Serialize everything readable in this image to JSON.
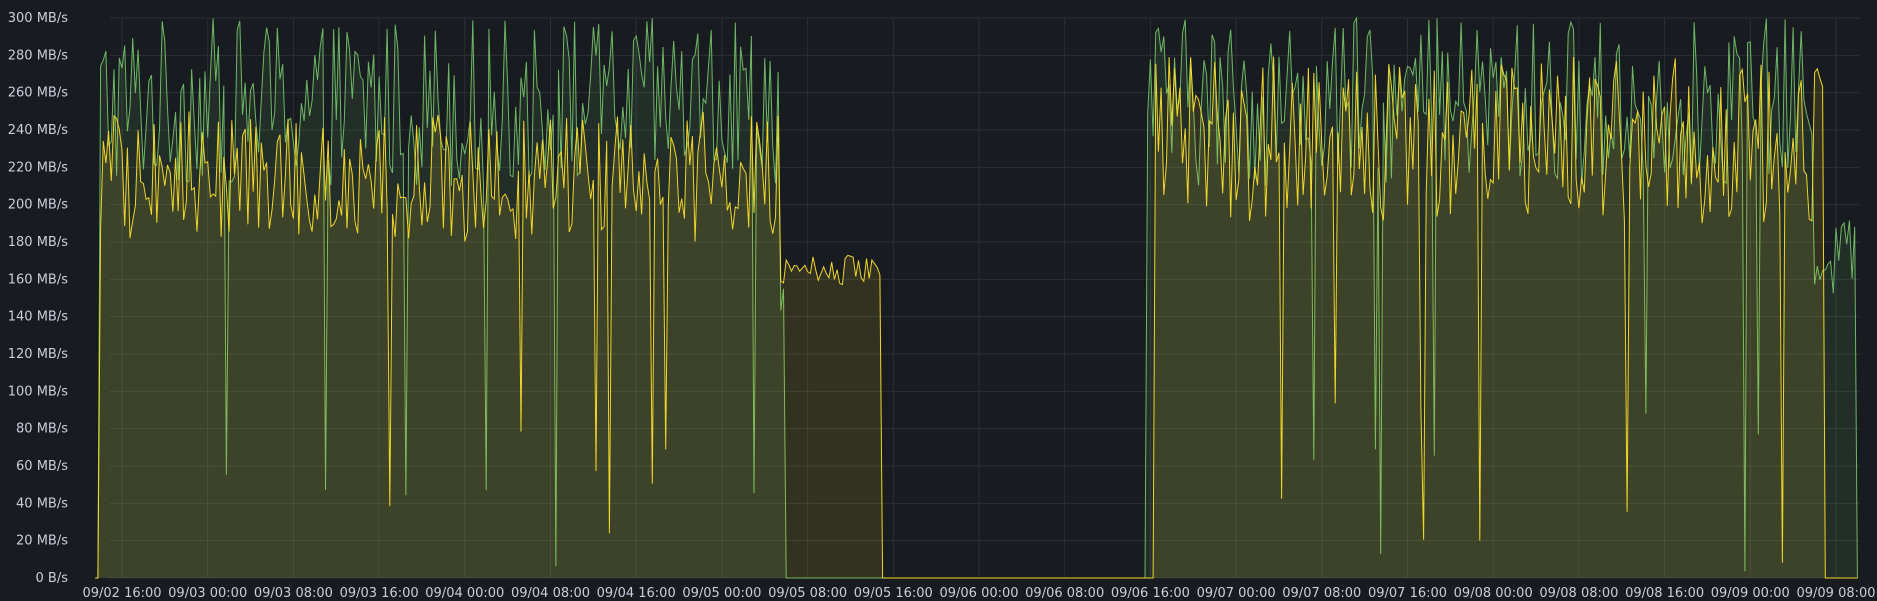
{
  "chart_data": {
    "type": "line",
    "title": "",
    "xlabel": "",
    "ylabel": "",
    "y_unit": "MB/s",
    "ylim": [
      0,
      300
    ],
    "grid": true,
    "legend": "none",
    "y_ticks": [
      "0 B/s",
      "20 MB/s",
      "40 MB/s",
      "60 MB/s",
      "80 MB/s",
      "100 MB/s",
      "120 MB/s",
      "140 MB/s",
      "160 MB/s",
      "180 MB/s",
      "200 MB/s",
      "220 MB/s",
      "240 MB/s",
      "260 MB/s",
      "280 MB/s",
      "300 MB/s"
    ],
    "x_ticks": [
      "09/02 16:00",
      "09/03 00:00",
      "09/03 08:00",
      "09/03 16:00",
      "09/04 00:00",
      "09/04 08:00",
      "09/04 16:00",
      "09/05 00:00",
      "09/05 08:00",
      "09/05 16:00",
      "09/06 00:00",
      "09/06 08:00",
      "09/06 16:00",
      "09/07 00:00",
      "09/07 08:00",
      "09/07 16:00",
      "09/08 00:00",
      "09/08 08:00",
      "09/08 16:00",
      "09/09 00:00",
      "09/09 08:00"
    ],
    "x_range": [
      "09/02 13:30",
      "09/09 10:00"
    ],
    "series": [
      {
        "color": "#73bf69",
        "segments": [
          {
            "start": "09/02 13:50",
            "end": "09/05 05:30",
            "level": 255,
            "spread": 45
          },
          {
            "start": "09/05 05:30",
            "end": "09/05 06:00",
            "level": 150,
            "spread": 10
          },
          {
            "start": "09/05 06:00",
            "end": "09/05 16:00",
            "level": 0,
            "spread": 0
          },
          {
            "start": "09/05 16:00",
            "end": "09/06 15:40",
            "level": 0,
            "spread": 0
          },
          {
            "start": "09/06 15:40",
            "end": "09/09 06:00",
            "level": 255,
            "spread": 45
          },
          {
            "start": "09/09 06:00",
            "end": "09/09 10:00",
            "level": 175,
            "spread": 25
          }
        ]
      },
      {
        "color": "#fade2a",
        "segments": [
          {
            "start": "09/02 14:00",
            "end": "09/05 05:30",
            "level": 215,
            "spread": 35
          },
          {
            "start": "09/05 05:30",
            "end": "09/05 14:50",
            "level": 165,
            "spread": 8
          },
          {
            "start": "09/05 14:50",
            "end": "09/06 15:40",
            "level": 0,
            "spread": 0
          },
          {
            "start": "09/06 16:30",
            "end": "09/09 07:00",
            "level": 235,
            "spread": 45
          },
          {
            "start": "09/09 07:00",
            "end": "09/09 09:30",
            "level": 0,
            "spread": 0
          }
        ]
      }
    ]
  }
}
